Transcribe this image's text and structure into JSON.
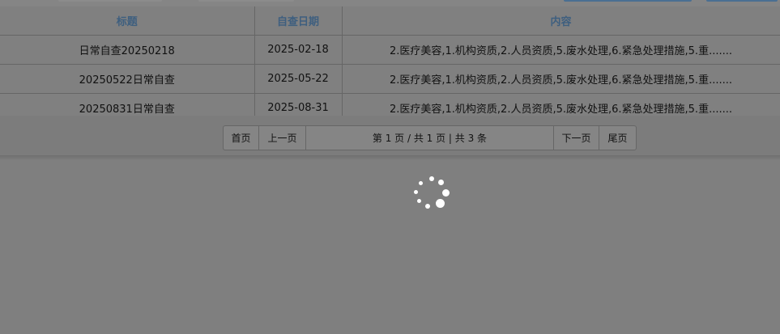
{
  "table": {
    "columns": [
      "标题",
      "自查日期",
      "内容"
    ],
    "rows": [
      {
        "title": "日常自查20250218",
        "date": "2025-02-18",
        "content": "2.医疗美容,1.机构资质,2.人员资质,5.废水处理,6.紧急处理措施,5.重......."
      },
      {
        "title": "20250522日常自查",
        "date": "2025-05-22",
        "content": "2.医疗美容,1.机构资质,2.人员资质,5.废水处理,6.紧急处理措施,5.重......."
      },
      {
        "title": "20250831日常自查",
        "date": "2025-08-31",
        "content": "2.医疗美容,1.机构资质,2.人员资质,5.废水处理,6.紧急处理措施,5.重......."
      }
    ]
  },
  "pager": {
    "first": "首页",
    "prev": "上一页",
    "info": "第 1 页 / 共 1 页 | 共 3 条",
    "next": "下一页",
    "last": "尾页"
  },
  "loading": {
    "icon": "spinner-icon"
  },
  "colors": {
    "overlay": "#7f7f7f",
    "header_text": "#3e5f7f"
  }
}
